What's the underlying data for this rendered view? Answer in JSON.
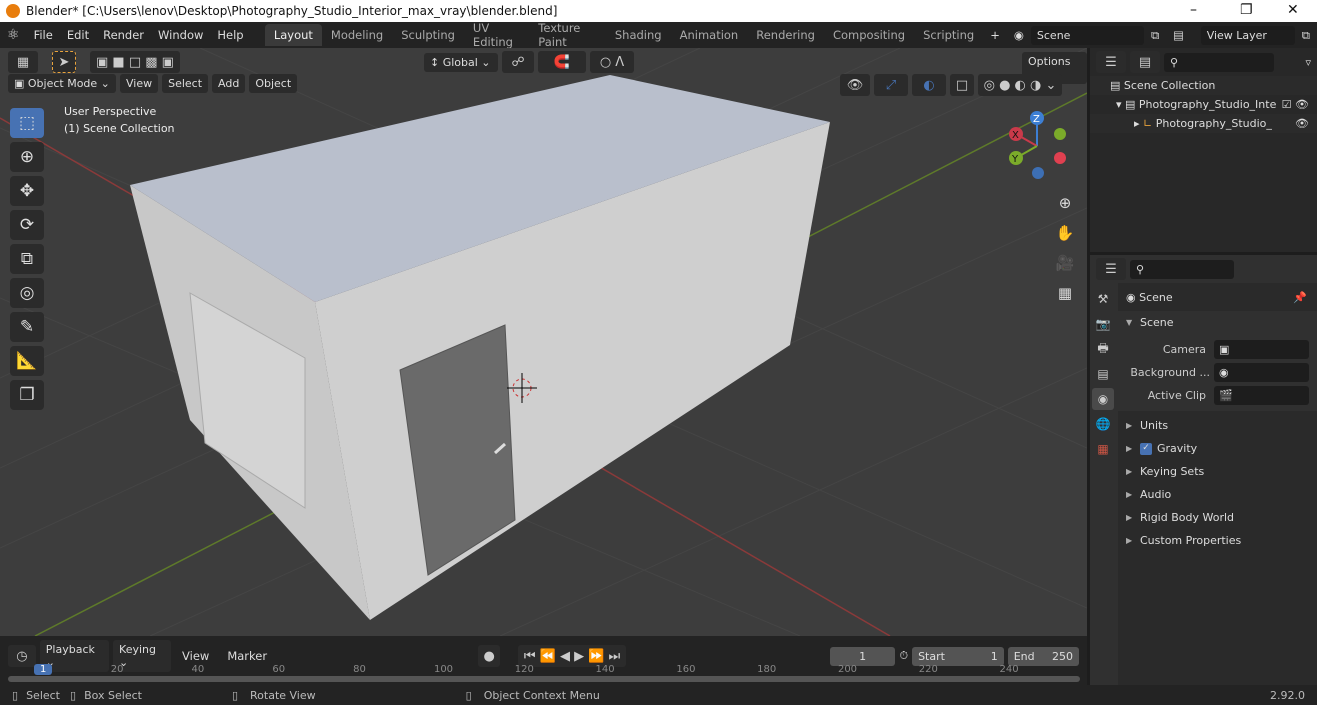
{
  "window": {
    "title": "Blender* [C:\\Users\\lenov\\Desktop\\Photography_Studio_Interior_max_vray\\blender.blend]"
  },
  "menu": [
    "File",
    "Edit",
    "Render",
    "Window",
    "Help"
  ],
  "workspaces": [
    "Layout",
    "Modeling",
    "Sculpting",
    "UV Editing",
    "Texture Paint",
    "Shading",
    "Animation",
    "Rendering",
    "Compositing",
    "Scripting"
  ],
  "scene_name": "Scene",
  "view_layer": "View Layer",
  "toolbar": {
    "orientation": "Global",
    "options": "Options"
  },
  "viewport_header": {
    "mode": "Object Mode",
    "menus": [
      "View",
      "Select",
      "Add",
      "Object"
    ]
  },
  "viewport": {
    "perspective": "User Perspective",
    "collection": "(1) Scene Collection"
  },
  "gizmo": {
    "x": "X",
    "y": "Y",
    "z": "Z"
  },
  "outliner": {
    "root": "Scene Collection",
    "items": [
      {
        "name": "Photography_Studio_Inte"
      },
      {
        "name": "Photography_Studio_"
      }
    ]
  },
  "properties": {
    "context": "Scene",
    "panel": "Scene",
    "camera_label": "Camera",
    "background_label": "Background ...",
    "active_clip_label": "Active Clip",
    "sections": [
      "Units",
      "Gravity",
      "Keying Sets",
      "Audio",
      "Rigid Body World",
      "Custom Properties"
    ],
    "gravity_checked": true
  },
  "timeline": {
    "menus": [
      "Playback",
      "Keying",
      "View",
      "Marker"
    ],
    "current_frame": "1",
    "start_label": "Start",
    "start": "1",
    "end_label": "End",
    "end": "250",
    "ruler": [
      "1",
      "20",
      "40",
      "60",
      "80",
      "100",
      "120",
      "140",
      "160",
      "180",
      "200",
      "220",
      "240"
    ]
  },
  "status": {
    "select": "Select",
    "box_select": "Box Select",
    "rotate": "Rotate View",
    "context_menu": "Object Context Menu",
    "version": "2.92.0"
  },
  "colors": {
    "accent": "#4772b3",
    "x_axis": "#c93a4a",
    "y_axis": "#7bab2a",
    "z_axis": "#3d7fd4"
  }
}
